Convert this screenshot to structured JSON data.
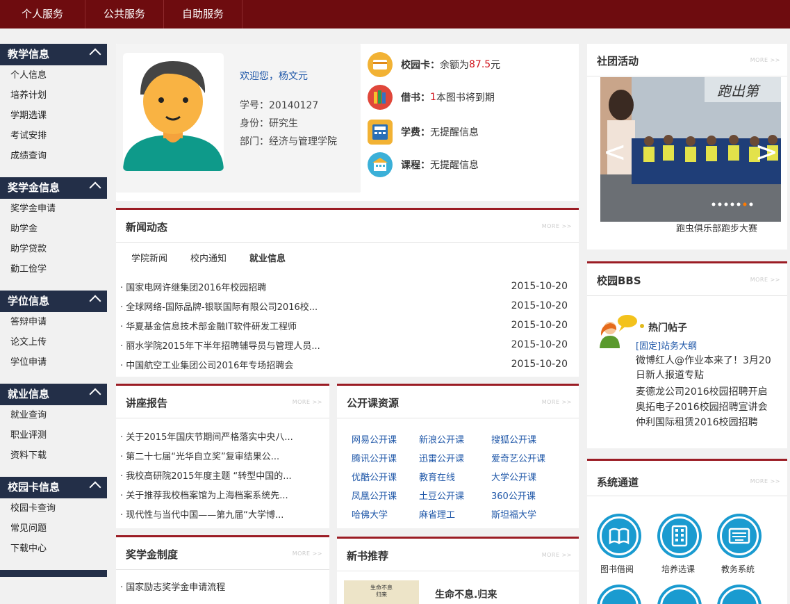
{
  "topnav": [
    "个人服务",
    "公共服务",
    "自助服务"
  ],
  "sidebar": [
    {
      "title": "教学信息",
      "items": [
        "个人信息",
        "培养计划",
        "学期选课",
        "考试安排",
        "成绩查询"
      ]
    },
    {
      "title": "奖学金信息",
      "items": [
        "奖学金申请",
        "助学金",
        "助学贷款",
        "勤工俭学"
      ]
    },
    {
      "title": "学位信息",
      "items": [
        "答辩申请",
        "论文上传",
        "学位申请"
      ]
    },
    {
      "title": "就业信息",
      "items": [
        "就业查询",
        "职业评测",
        "资料下载"
      ]
    },
    {
      "title": "校园卡信息",
      "items": [
        "校园卡查询",
        "常见问题",
        "下载中心"
      ]
    }
  ],
  "profile": {
    "welcome": "欢迎您，杨文元",
    "student_id": "学号：20140127",
    "identity": "身份：研究生",
    "dept": "部门：经济与管理学院"
  },
  "alerts": {
    "card_label": "校园卡：",
    "card_text": "余额为",
    "card_amount": "87.5",
    "card_unit": "元",
    "book_label": "借书：",
    "book_count": "1",
    "book_text": "本图书将到期",
    "fee_label": "学费：",
    "fee_text": "无提醒信息",
    "course_label": "课程：",
    "course_text": "无提醒信息"
  },
  "more_label": "MORE >>",
  "news": {
    "title": "新闻动态",
    "tabs": [
      "学院新闻",
      "校内通知",
      "就业信息"
    ],
    "active_tab": "就业信息",
    "rows": [
      {
        "title": "· 国家电网许继集团2016年校园招聘",
        "date": "2015-10-20"
      },
      {
        "title": "· 全球网络-国际品牌-银联国际有限公司2016校...",
        "date": "2015-10-20"
      },
      {
        "title": "· 华夏基金信息技术部金融IT软件研发工程师",
        "date": "2015-10-20"
      },
      {
        "title": "· 丽水学院2015年下半年招聘辅导员与管理人员...",
        "date": "2015-10-20"
      },
      {
        "title": "· 中国航空工业集团公司2016年专场招聘会",
        "date": "2015-10-20"
      }
    ]
  },
  "lectures": {
    "title": "讲座报告",
    "rows": [
      "· 关于2015年国庆节期间严格落实中央八...",
      "· 第二十七届“光华自立奖”复审结果公...",
      "· 我校高研院2015年度主题 “转型中国的...",
      "· 关于推荐我校档案馆为上海档案系统先...",
      "· 现代性与当代中国——第九届“大学博..."
    ]
  },
  "open_courses": {
    "title": "公开课资源",
    "rows": [
      [
        "网易公开课",
        "新浪公开课",
        "搜狐公开课"
      ],
      [
        "腾讯公开课",
        "迅雷公开课",
        "爱奇艺公开课"
      ],
      [
        "优酷公开课",
        "教育在线",
        "大学公开课"
      ],
      [
        "凤凰公开课",
        "土豆公开课",
        "360公开课"
      ],
      [
        "哈佛大学",
        "麻省理工",
        "斯坦福大学"
      ]
    ]
  },
  "scholarship": {
    "title": "奖学金制度",
    "rows": [
      "· 国家励志奖学金申请流程"
    ]
  },
  "new_books": {
    "title": "新书推荐",
    "book_title": "生命不息.归来",
    "cover_text": "生命不息",
    "cover_sub": "归来"
  },
  "clubs": {
    "title": "社团活动",
    "caption": "跑虫俱乐部跑步大赛",
    "banner_text": "跑出第",
    "prev": "<",
    "next": ">"
  },
  "bbs": {
    "title": "校园BBS",
    "hot": "热门帖子",
    "pinned": "[固定]站务大纲",
    "posts": [
      "微博红人@作业本来了！3月20日新人报道专贴",
      "麦德龙公司2016校园招聘开启",
      "奥拓电子2016校园招聘宣讲会",
      "仲利国际租赁2016校园招聘"
    ]
  },
  "system": {
    "title": "系统通道",
    "items": [
      "图书借阅",
      "培养选课",
      "教务系统"
    ]
  },
  "colors": {
    "brand": "#6e0c0f",
    "sidebar": "#232f48",
    "accent_red": "#9b1c24",
    "link_blue": "#1f57a8",
    "icon_blue": "#1a9bd0"
  }
}
